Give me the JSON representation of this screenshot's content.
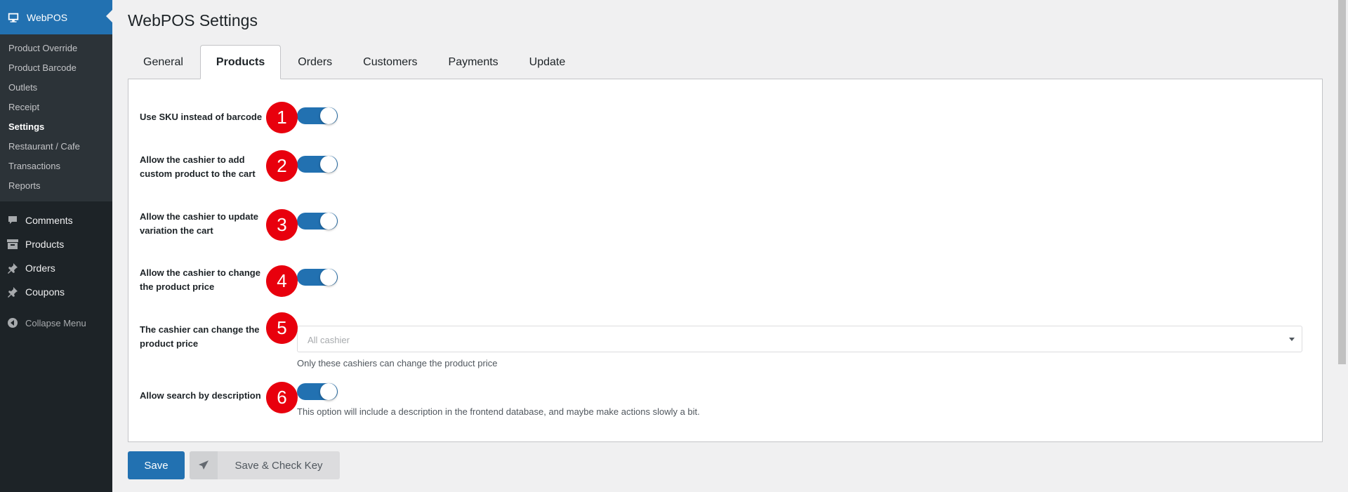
{
  "sidebar": {
    "header": "WebPOS",
    "submenu": [
      {
        "label": "Product Override"
      },
      {
        "label": "Product Barcode"
      },
      {
        "label": "Outlets"
      },
      {
        "label": "Receipt"
      },
      {
        "label": "Settings"
      },
      {
        "label": "Restaurant / Cafe"
      },
      {
        "label": "Transactions"
      },
      {
        "label": "Reports"
      }
    ],
    "menu": [
      {
        "label": "Comments",
        "icon": "comment-icon"
      },
      {
        "label": "Products",
        "icon": "archive-icon"
      },
      {
        "label": "Orders",
        "icon": "pin-icon"
      },
      {
        "label": "Coupons",
        "icon": "pin-icon"
      }
    ],
    "collapse": "Collapse Menu"
  },
  "page": {
    "title": "WebPOS Settings"
  },
  "tabs": [
    {
      "label": "General"
    },
    {
      "label": "Products"
    },
    {
      "label": "Orders"
    },
    {
      "label": "Customers"
    },
    {
      "label": "Payments"
    },
    {
      "label": "Update"
    }
  ],
  "settings": {
    "sku": {
      "label": "Use SKU instead of barcode",
      "badge": "1",
      "enabled": true
    },
    "custom_product": {
      "label": "Allow the cashier to add custom product to the cart",
      "badge": "2",
      "enabled": true
    },
    "update_variation": {
      "label": "Allow the cashier to update variation the cart",
      "badge": "3",
      "enabled": true
    },
    "change_price": {
      "label": "Allow the cashier to change the product price",
      "badge": "4",
      "enabled": true
    },
    "price_cashiers": {
      "label": "The cashier can change the product price",
      "badge": "5",
      "placeholder": "All cashier",
      "help": "Only these cashiers can change the product price"
    },
    "search_description": {
      "label": "Allow search by description",
      "badge": "6",
      "enabled": true,
      "help": "This option will include a description in the frontend database, and maybe make actions slowly a bit."
    }
  },
  "buttons": {
    "save": "Save",
    "save_check": "Save & Check Key"
  },
  "colors": {
    "accent": "#2271b1",
    "sidebar": "#1d2327",
    "badge": "#e8000d"
  }
}
